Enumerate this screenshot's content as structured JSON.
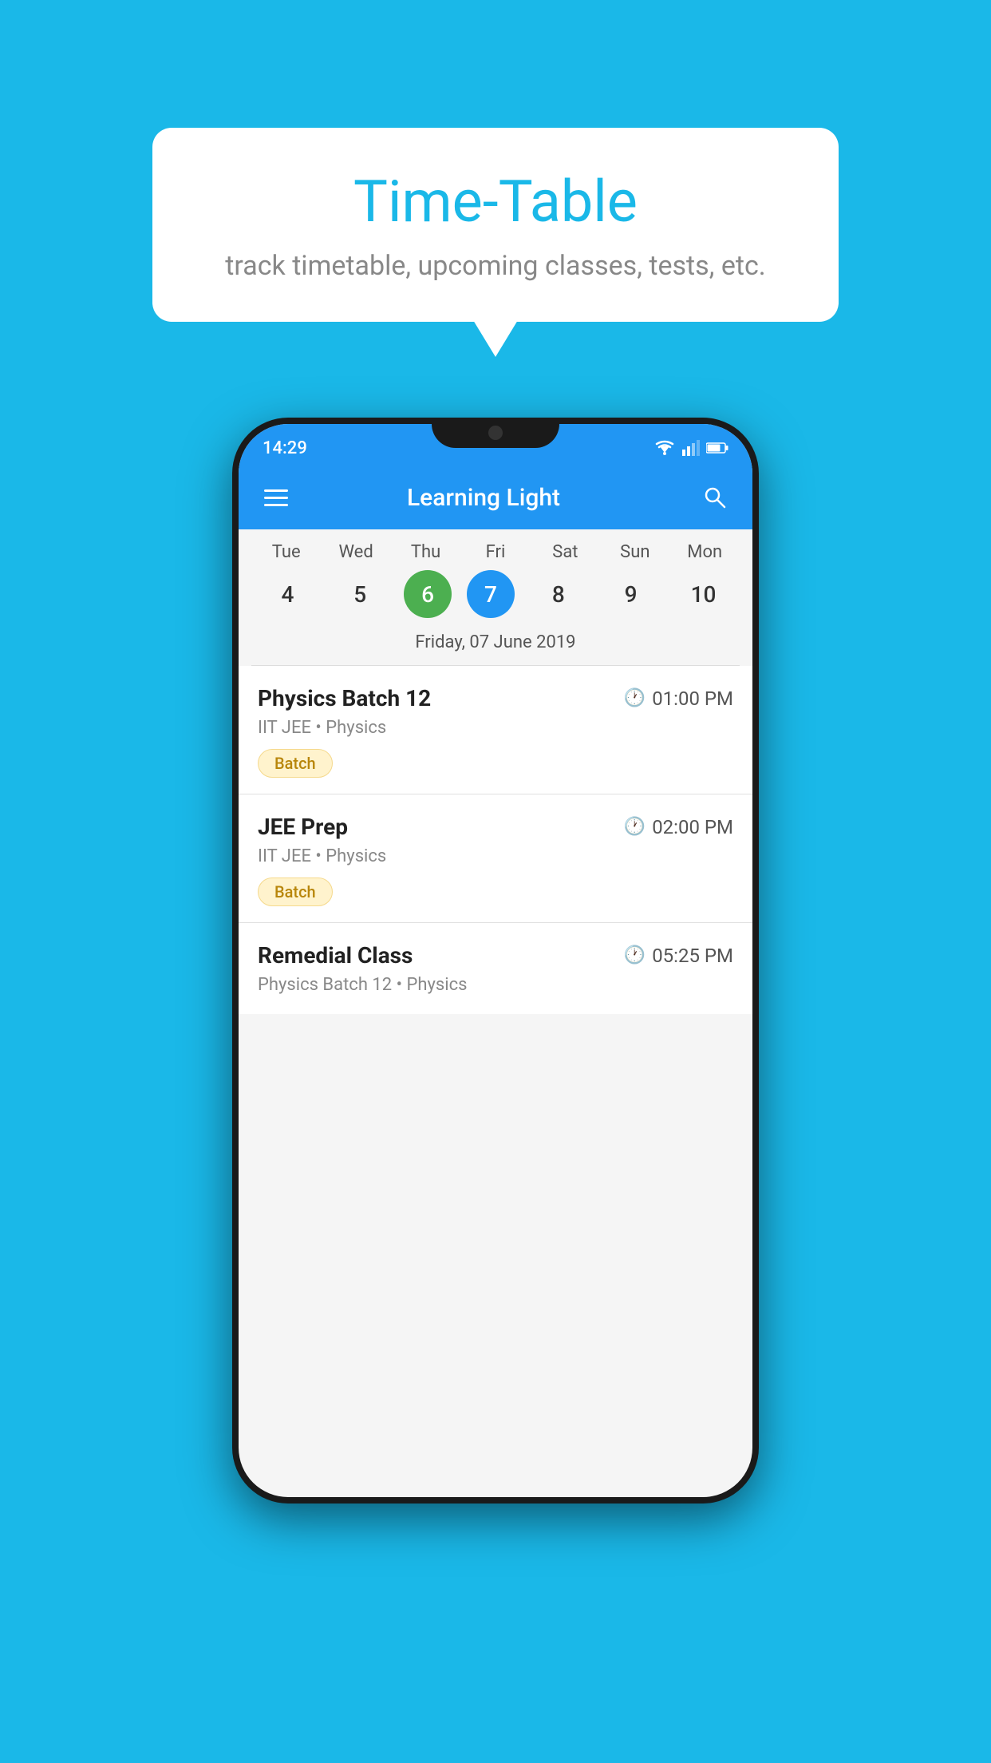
{
  "page": {
    "background_color": "#1ab8e8"
  },
  "bubble": {
    "title": "Time-Table",
    "subtitle": "track timetable, upcoming classes, tests, etc."
  },
  "phone": {
    "status_bar": {
      "time": "14:29"
    },
    "app_bar": {
      "title": "Learning Light"
    },
    "calendar": {
      "days": [
        {
          "name": "Tue",
          "number": "4",
          "state": "normal"
        },
        {
          "name": "Wed",
          "number": "5",
          "state": "normal"
        },
        {
          "name": "Thu",
          "number": "6",
          "state": "today"
        },
        {
          "name": "Fri",
          "number": "7",
          "state": "selected"
        },
        {
          "name": "Sat",
          "number": "8",
          "state": "normal"
        },
        {
          "name": "Sun",
          "number": "9",
          "state": "normal"
        },
        {
          "name": "Mon",
          "number": "10",
          "state": "normal"
        }
      ],
      "selected_date_label": "Friday, 07 June 2019"
    },
    "schedule": {
      "items": [
        {
          "title": "Physics Batch 12",
          "time": "01:00 PM",
          "subtitle": "IIT JEE • Physics",
          "tag": "Batch"
        },
        {
          "title": "JEE Prep",
          "time": "02:00 PM",
          "subtitle": "IIT JEE • Physics",
          "tag": "Batch"
        },
        {
          "title": "Remedial Class",
          "time": "05:25 PM",
          "subtitle": "Physics Batch 12 • Physics",
          "tag": null
        }
      ]
    }
  }
}
